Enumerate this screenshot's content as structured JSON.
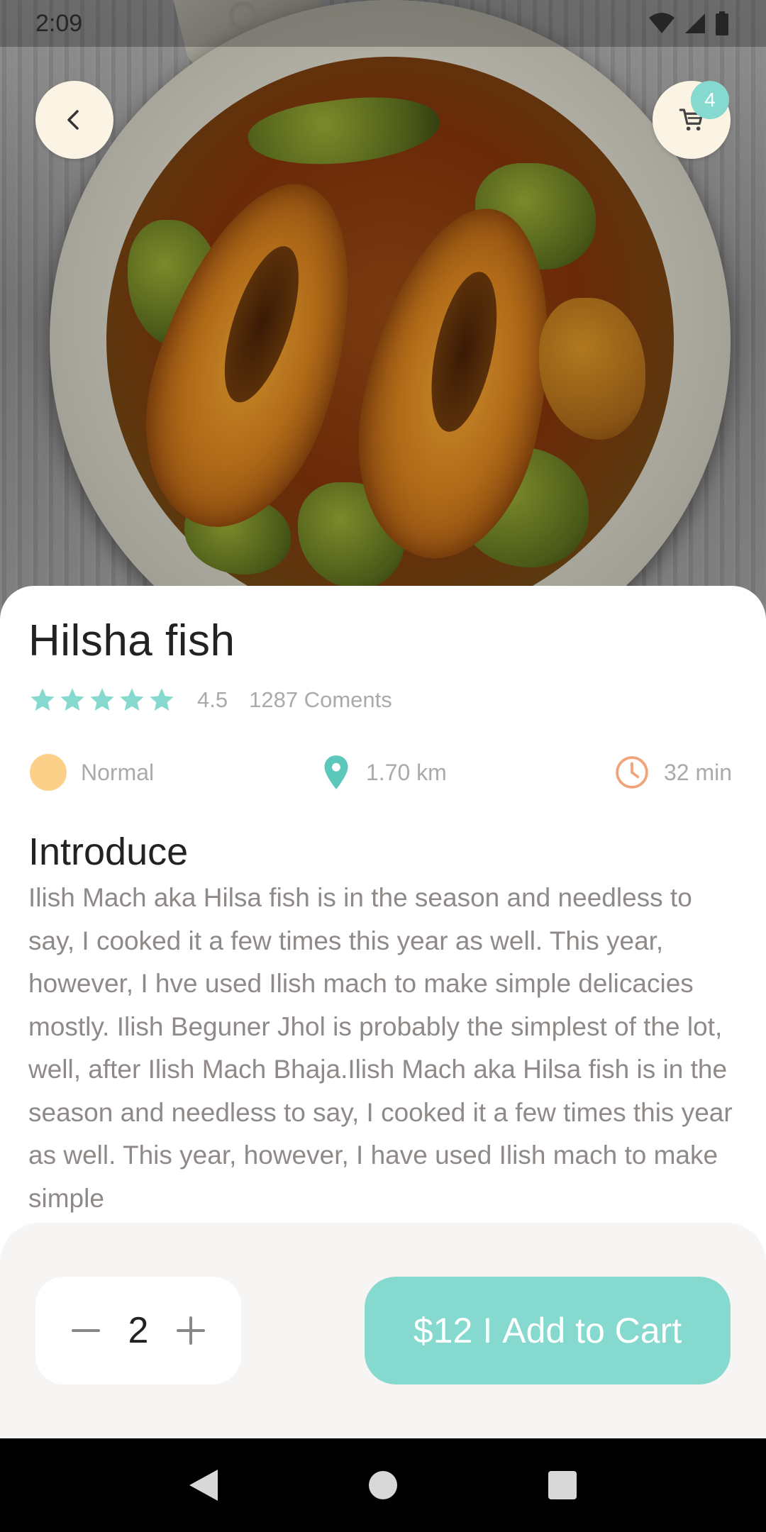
{
  "status_bar": {
    "time": "2:09"
  },
  "header": {
    "cart_count": "4"
  },
  "product": {
    "name": "Hilsha fish",
    "rating_value": "4.5",
    "rating_fraction": 0.9,
    "comments": "1287 Coments",
    "spice_level": "Normal",
    "distance": "1.70 km",
    "time": "32 min"
  },
  "intro": {
    "heading": "Introduce",
    "text": "Ilish Mach aka Hilsa fish is in the season and needless to say, I cooked it a few times this year as well. This year, however, I hve used Ilish mach to make simple delicacies mostly. Ilish Beguner Jhol is probably the simplest of the lot, well, after Ilish Mach Bhaja.Ilish Mach aka Hilsa fish is in the season and needless to say, I cooked it a few times this year as well. This year, however, I have used Ilish mach to make simple"
  },
  "order": {
    "quantity": "2",
    "price": "$12",
    "separator": "I",
    "add_label": "Add to Cart"
  },
  "colors": {
    "accent": "#86d9cf",
    "orange_icon": "#f3a37a",
    "dot_yellow": "#fdd08a",
    "cream": "#fbf3e4"
  },
  "icons": [
    "back-arrow-icon",
    "cart-icon",
    "star-icon",
    "location-pin-icon",
    "clock-icon",
    "minus-icon",
    "plus-icon",
    "nav-back-icon",
    "nav-home-icon",
    "nav-recents-icon"
  ]
}
